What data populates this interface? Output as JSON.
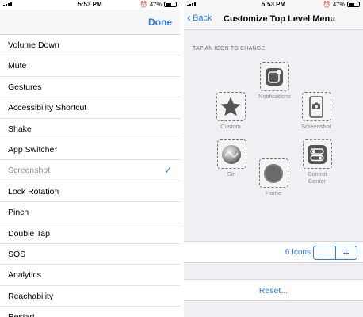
{
  "status_left": {
    "time": "5:53 PM",
    "carrier": "",
    "battery": "47%",
    "battery_level": 0.47
  },
  "status_right": {
    "time": "5:53 PM",
    "battery": "47%",
    "battery_level": 0.47
  },
  "left_nav": {
    "done_label": "Done"
  },
  "actions": [
    {
      "label": "Volume Down",
      "selected": false
    },
    {
      "label": "Mute",
      "selected": false
    },
    {
      "label": "Gestures",
      "selected": false
    },
    {
      "label": "Accessibility Shortcut",
      "selected": false
    },
    {
      "label": "Shake",
      "selected": false
    },
    {
      "label": "App Switcher",
      "selected": false
    },
    {
      "label": "Screenshot",
      "selected": true
    },
    {
      "label": "Lock Rotation",
      "selected": false
    },
    {
      "label": "Pinch",
      "selected": false
    },
    {
      "label": "Double Tap",
      "selected": false
    },
    {
      "label": "SOS",
      "selected": false
    },
    {
      "label": "Analytics",
      "selected": false
    },
    {
      "label": "Reachability",
      "selected": false
    },
    {
      "label": "Restart",
      "selected": false
    }
  ],
  "right_nav": {
    "back_label": "Back",
    "title": "Customize Top Level Menu"
  },
  "section_header": "TAP AN ICON TO CHANGE:",
  "icons": {
    "notifications": {
      "label": "Notifications",
      "icon": "notifications-icon"
    },
    "custom": {
      "label": "Custom",
      "icon": "star-icon"
    },
    "screenshot": {
      "label": "Screenshot",
      "icon": "camera-phone-icon"
    },
    "siri": {
      "label": "Siri",
      "icon": "siri-icon"
    },
    "control_center": {
      "label": "Control\nCenter",
      "icon": "toggle-icon"
    },
    "home": {
      "label": "Home",
      "icon": "home-button-icon"
    }
  },
  "stepper": {
    "label": "6 Icons",
    "minus": "—",
    "plus": "+"
  },
  "reset_label": "Reset...",
  "colors": {
    "accent": "#2f7af0",
    "background": "#efeff4"
  }
}
